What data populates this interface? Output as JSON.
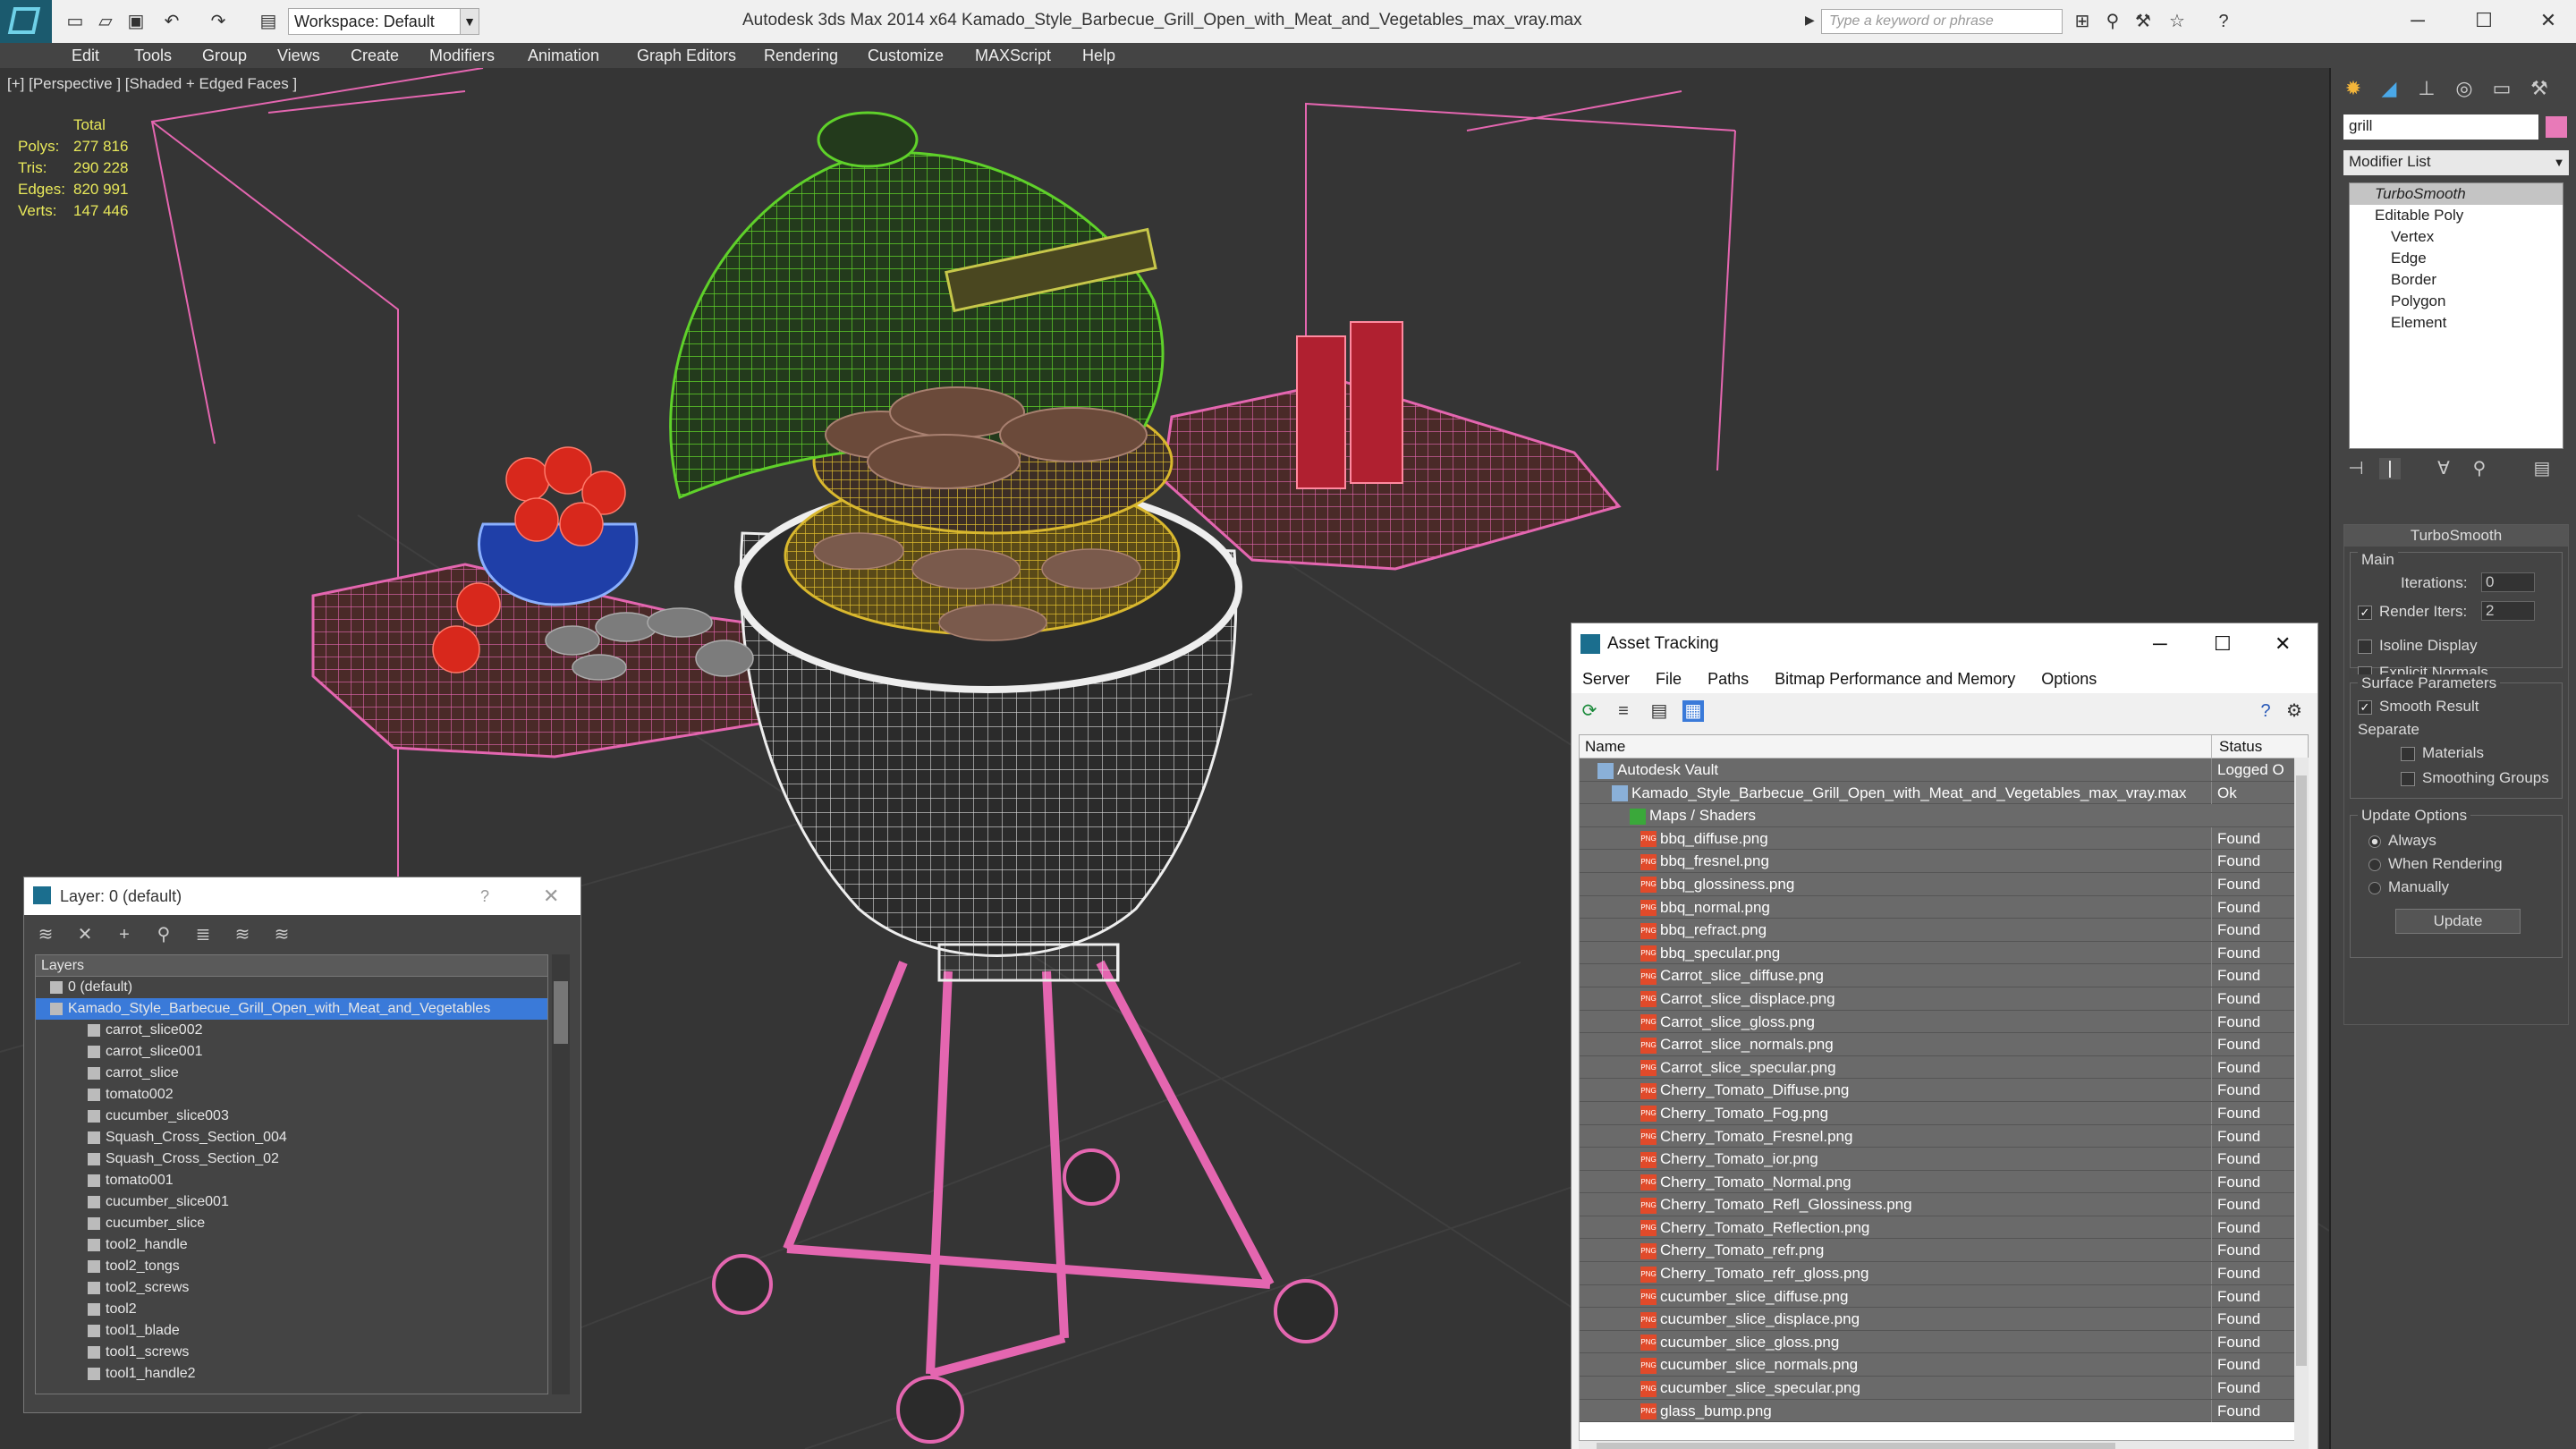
{
  "app": {
    "title": "Autodesk 3ds Max  2014 x64     Kamado_Style_Barbecue_Grill_Open_with_Meat_and_Vegetables_max_vray.max",
    "workspace": "Workspace: Default",
    "search_placeholder": "Type a keyword or phrase"
  },
  "menu": [
    "Edit",
    "Tools",
    "Group",
    "Views",
    "Create",
    "Modifiers",
    "Animation",
    "Graph Editors",
    "Rendering",
    "Customize",
    "MAXScript",
    "Help"
  ],
  "viewport": {
    "label": "[+] [Perspective ] [Shaded + Edged Faces ]",
    "stats": {
      "header": "Total",
      "rows": [
        {
          "k": "Polys:",
          "v": "277 816"
        },
        {
          "k": "Tris:",
          "v": "290 228"
        },
        {
          "k": "Edges:",
          "v": "820 991"
        },
        {
          "k": "Verts:",
          "v": "147 446"
        }
      ]
    }
  },
  "command_panel": {
    "name_field": "grill",
    "modifier_list": "Modifier List",
    "stack": [
      "TurboSmooth",
      "Editable Poly",
      "Vertex",
      "Edge",
      "Border",
      "Polygon",
      "Element"
    ],
    "rollout_title": "TurboSmooth",
    "main": "Main",
    "iterations_label": "Iterations:",
    "iterations": "0",
    "render_iters_label": "Render Iters:",
    "render_iters": "2",
    "isoline": "Isoline Display",
    "explicit_normals": "Explicit Normals",
    "surface_params": "Surface Parameters",
    "smooth_result": "Smooth Result",
    "separate": "Separate",
    "materials": "Materials",
    "smoothing_groups": "Smoothing Groups",
    "update_options": "Update Options",
    "always": "Always",
    "when_rendering": "When Rendering",
    "manually": "Manually",
    "update_btn": "Update"
  },
  "asset_tracking": {
    "title": "Asset Tracking",
    "menu": [
      "Server",
      "File",
      "Paths",
      "Bitmap Performance and Memory",
      "Options"
    ],
    "col_name": "Name",
    "col_status": "Status",
    "rows": [
      {
        "n": "Autodesk Vault",
        "s": "Logged O",
        "lvl": 0
      },
      {
        "n": "Kamado_Style_Barbecue_Grill_Open_with_Meat_and_Vegetables_max_vray.max",
        "s": "Ok",
        "lvl": 1
      },
      {
        "n": "Maps / Shaders",
        "s": "",
        "lvl": 2
      },
      {
        "n": "bbq_diffuse.png",
        "s": "Found",
        "lvl": 3
      },
      {
        "n": "bbq_fresnel.png",
        "s": "Found",
        "lvl": 3
      },
      {
        "n": "bbq_glossiness.png",
        "s": "Found",
        "lvl": 3
      },
      {
        "n": "bbq_normal.png",
        "s": "Found",
        "lvl": 3
      },
      {
        "n": "bbq_refract.png",
        "s": "Found",
        "lvl": 3
      },
      {
        "n": "bbq_specular.png",
        "s": "Found",
        "lvl": 3
      },
      {
        "n": "Carrot_slice_diffuse.png",
        "s": "Found",
        "lvl": 3
      },
      {
        "n": "Carrot_slice_displace.png",
        "s": "Found",
        "lvl": 3
      },
      {
        "n": "Carrot_slice_gloss.png",
        "s": "Found",
        "lvl": 3
      },
      {
        "n": "Carrot_slice_normals.png",
        "s": "Found",
        "lvl": 3
      },
      {
        "n": "Carrot_slice_specular.png",
        "s": "Found",
        "lvl": 3
      },
      {
        "n": "Cherry_Tomato_Diffuse.png",
        "s": "Found",
        "lvl": 3
      },
      {
        "n": "Cherry_Tomato_Fog.png",
        "s": "Found",
        "lvl": 3
      },
      {
        "n": "Cherry_Tomato_Fresnel.png",
        "s": "Found",
        "lvl": 3
      },
      {
        "n": "Cherry_Tomato_ior.png",
        "s": "Found",
        "lvl": 3
      },
      {
        "n": "Cherry_Tomato_Normal.png",
        "s": "Found",
        "lvl": 3
      },
      {
        "n": "Cherry_Tomato_Refl_Glossiness.png",
        "s": "Found",
        "lvl": 3
      },
      {
        "n": "Cherry_Tomato_Reflection.png",
        "s": "Found",
        "lvl": 3
      },
      {
        "n": "Cherry_Tomato_refr.png",
        "s": "Found",
        "lvl": 3
      },
      {
        "n": "Cherry_Tomato_refr_gloss.png",
        "s": "Found",
        "lvl": 3
      },
      {
        "n": "cucumber_slice_diffuse.png",
        "s": "Found",
        "lvl": 3
      },
      {
        "n": "cucumber_slice_displace.png",
        "s": "Found",
        "lvl": 3
      },
      {
        "n": "cucumber_slice_gloss.png",
        "s": "Found",
        "lvl": 3
      },
      {
        "n": "cucumber_slice_normals.png",
        "s": "Found",
        "lvl": 3
      },
      {
        "n": "cucumber_slice_specular.png",
        "s": "Found",
        "lvl": 3
      },
      {
        "n": "glass_bump.png",
        "s": "Found",
        "lvl": 3
      }
    ]
  },
  "layer_explorer": {
    "title": "Layer: 0 (default)",
    "col": "Layers",
    "rows": [
      {
        "n": "0 (default)",
        "lvl": 0
      },
      {
        "n": "Kamado_Style_Barbecue_Grill_Open_with_Meat_and_Vegetables",
        "lvl": 0,
        "sel": true
      },
      {
        "n": "carrot_slice002",
        "lvl": 1
      },
      {
        "n": "carrot_slice001",
        "lvl": 1
      },
      {
        "n": "carrot_slice",
        "lvl": 1
      },
      {
        "n": "tomato002",
        "lvl": 1
      },
      {
        "n": "cucumber_slice003",
        "lvl": 1
      },
      {
        "n": "Squash_Cross_Section_004",
        "lvl": 1
      },
      {
        "n": "Squash_Cross_Section_02",
        "lvl": 1
      },
      {
        "n": "tomato001",
        "lvl": 1
      },
      {
        "n": "cucumber_slice001",
        "lvl": 1
      },
      {
        "n": "cucumber_slice",
        "lvl": 1
      },
      {
        "n": "tool2_handle",
        "lvl": 1
      },
      {
        "n": "tool2_tongs",
        "lvl": 1
      },
      {
        "n": "tool2_screws",
        "lvl": 1
      },
      {
        "n": "tool2",
        "lvl": 1
      },
      {
        "n": "tool1_blade",
        "lvl": 1
      },
      {
        "n": "tool1_screws",
        "lvl": 1
      },
      {
        "n": "tool1_handle2",
        "lvl": 1
      }
    ]
  }
}
